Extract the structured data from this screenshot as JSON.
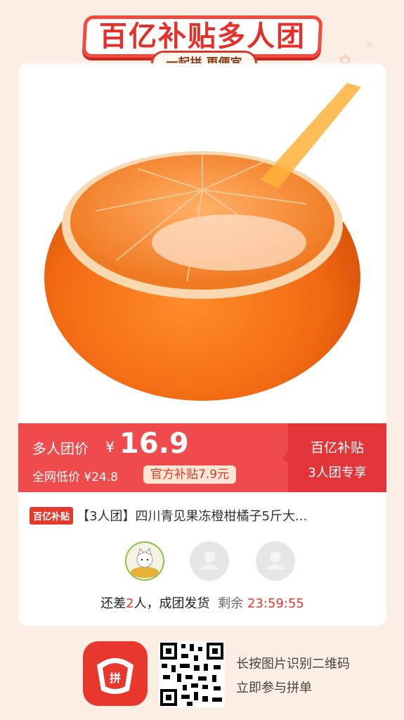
{
  "header": {
    "title": "百亿补贴多人团",
    "subtitle": "一起拼 更便宜"
  },
  "product": {
    "image_desc_icon": "orange-fruit-image"
  },
  "price_bar": {
    "group_label": "多人团价",
    "currency": "¥",
    "group_price": "16.9",
    "low_price_label": "全网低价 ¥24.8",
    "subsidy_badge": "官方补贴7.9元",
    "right_line1": "百亿补贴",
    "right_line2": "3人团专享"
  },
  "title_row": {
    "tag": "百亿补贴",
    "title": "【3人团】四川青见果冻橙柑橘子5斤大..."
  },
  "status": {
    "prefix": "还差",
    "count": "2",
    "suffix": "人，成团发货",
    "remaining_label": "剩余",
    "countdown": "23:59:55"
  },
  "footer": {
    "hint_line1": "长按图片识别二维码",
    "hint_line2": "立即参与拼单"
  },
  "colors": {
    "brand_red": "#e3312a",
    "price_bar": "#ef4a4c",
    "background": "#fdeee4"
  }
}
